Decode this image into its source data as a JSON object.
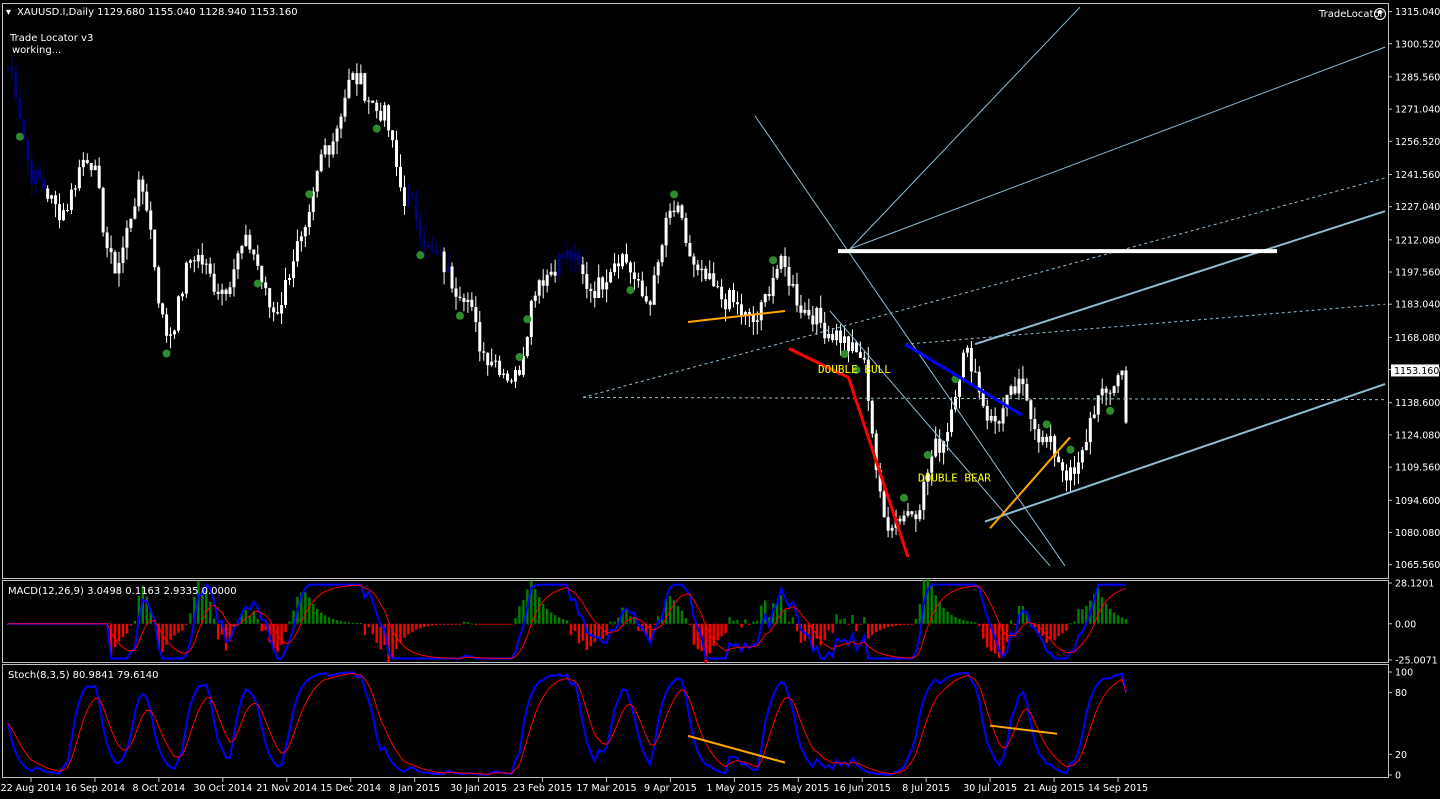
{
  "header": {
    "symbol_line": "XAUUSD.I,Daily  1129.680 1155.040 1128.940 1153.160",
    "indicator_name": "Trade Locator v3",
    "indicator_status": "working...",
    "tradelocator_label": "TradeLocator"
  },
  "chart_data": [
    {
      "type": "candlestick",
      "symbol": "XAUUSD.I",
      "timeframe": "Daily",
      "ohlc_last": {
        "open": 1129.68,
        "high": 1155.04,
        "low": 1128.94,
        "close": 1153.16
      },
      "current_price_label": "1153.160",
      "ylim": [
        1060,
        1318
      ],
      "y_ticks": [
        "1315.040",
        "1300.520",
        "1285.560",
        "1271.040",
        "1256.520",
        "1241.560",
        "1227.040",
        "1212.080",
        "1197.560",
        "1183.040",
        "1168.080",
        "1153.560",
        "1138.600",
        "1124.080",
        "1109.560",
        "1094.600",
        "1080.080",
        "1065.560"
      ],
      "x_ticks": [
        "22 Aug 2014",
        "16 Sep 2014",
        "8 Oct 2014",
        "30 Oct 2014",
        "21 Nov 2014",
        "15 Dec 2014",
        "8 Jan 2015",
        "30 Jan 2015",
        "23 Feb 2015",
        "17 Mar 2015",
        "9 Apr 2015",
        "1 May 2015",
        "25 May 2015",
        "16 Jun 2015",
        "8 Jul 2015",
        "30 Jul 2015",
        "21 Aug 2015",
        "14 Sep 2015"
      ],
      "key_closes": [
        1290,
        1240,
        1225,
        1250,
        1200,
        1235,
        1170,
        1205,
        1190,
        1210,
        1180,
        1210,
        1255,
        1285,
        1270,
        1230,
        1205,
        1190,
        1160,
        1150,
        1195,
        1205,
        1190,
        1205,
        1185,
        1225,
        1195,
        1185,
        1175,
        1200,
        1180,
        1170,
        1160,
        1085,
        1090,
        1120,
        1160,
        1130,
        1145,
        1120,
        1105,
        1140,
        1153.16
      ],
      "pattern_labels": [
        "DOUBLE BULL",
        "DOUBLE BEAR"
      ]
    },
    {
      "type": "line",
      "name": "MACD(12,26,9) 3.0498 0.1163 2.9335 0.0000",
      "y_ticks": [
        "28.1201",
        "0.00",
        "-25.0071"
      ],
      "ylim": [
        -25.0071,
        28.1201
      ]
    },
    {
      "type": "line",
      "name": "Stoch(8,3,5) 80.9841 79.6140",
      "y_ticks": [
        "100",
        "80",
        "20",
        "0"
      ],
      "ylim": [
        0,
        100
      ]
    }
  ],
  "colors": {
    "background": "#000000",
    "candle": "#ffffff",
    "candle_early": "#00007a",
    "pivot": "#2e8b2e",
    "channel": "#8fbcd4",
    "macd_main": "#0000ff",
    "macd_signal": "#ff0000",
    "hist_pos": "#008000",
    "hist_neg": "#ff0000",
    "orange": "#ffa500",
    "pattern_text": "#ffff00"
  }
}
